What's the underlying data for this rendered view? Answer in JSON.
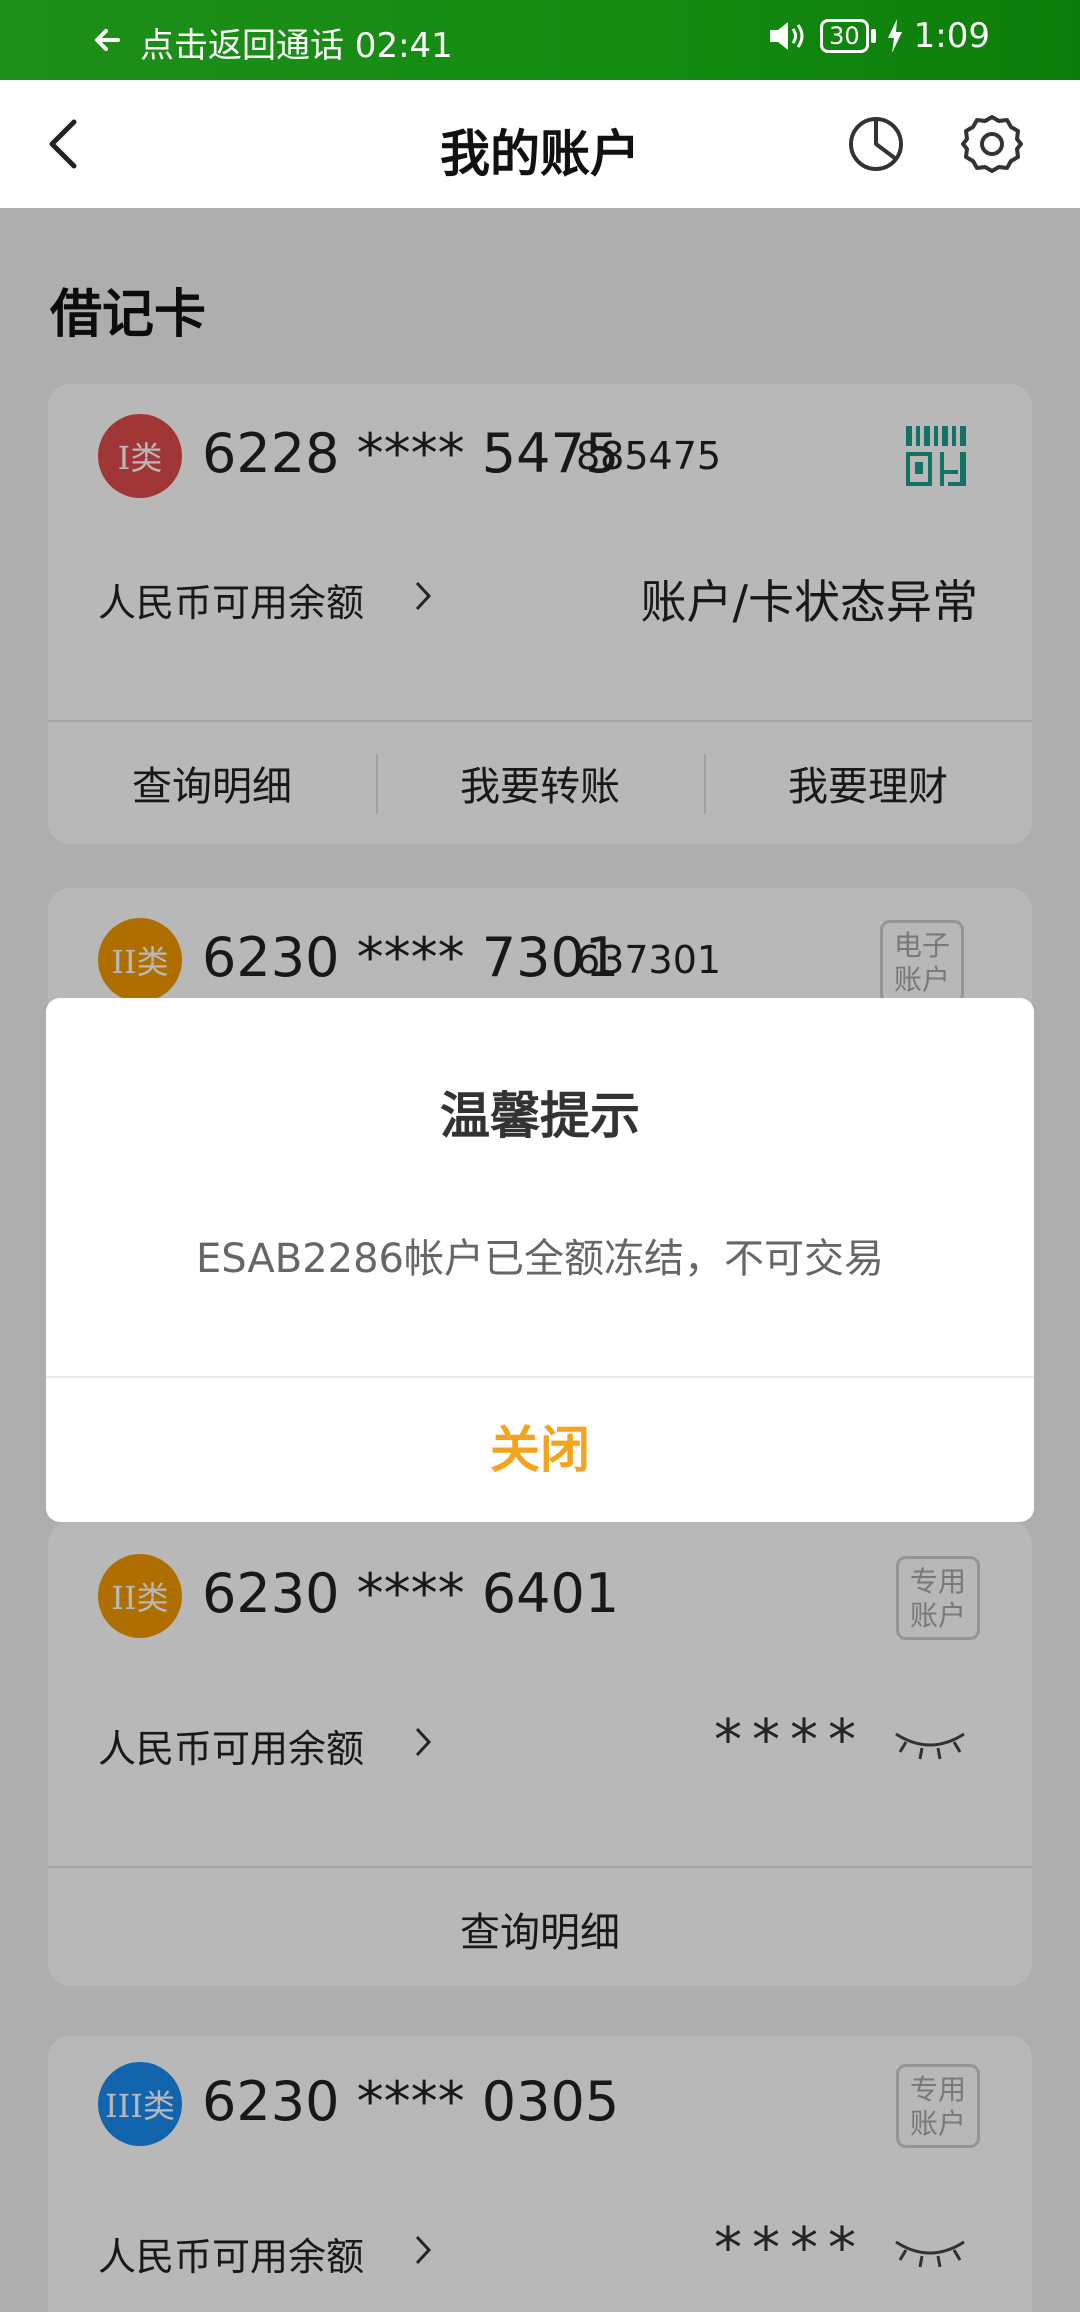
{
  "status_bar": {
    "call_text": "点击返回通话 02:41",
    "battery": "30",
    "time": "1:09"
  },
  "nav": {
    "title": "我的账户"
  },
  "section": {
    "title": "借记卡"
  },
  "cards": [
    {
      "badge": "I类",
      "number": "6228 **** 5475",
      "short": "885475",
      "balance_label": "人民币可用余额",
      "status": "账户/卡状态异常",
      "actions": [
        "查询明细",
        "我要转账",
        "我要理财"
      ]
    },
    {
      "badge": "II类",
      "number": "6230 **** 7301",
      "short": "637301",
      "tag": [
        "电子",
        "账户"
      ]
    },
    {
      "badge": "II类",
      "number": "6230 **** 6401",
      "tag": [
        "专用",
        "账户"
      ],
      "balance_label": "人民币可用余额",
      "masked": "****",
      "actions": [
        "查询明细"
      ]
    },
    {
      "badge": "III类",
      "number": "6230 **** 0305",
      "tag": [
        "专用",
        "账户"
      ],
      "balance_label": "人民币可用余额",
      "masked": "****"
    }
  ],
  "dialog": {
    "title": "温馨提示",
    "message": "ESAB2286帐户已全额冻结，不可交易",
    "button": "关闭"
  },
  "colors": {
    "status_bar": "#138a10",
    "badge_red": "#e04c4c",
    "badge_orange": "#f29a00",
    "badge_blue": "#1a8cf0",
    "accent": "#f5a31a",
    "qr_teal": "#1a9e8a"
  }
}
